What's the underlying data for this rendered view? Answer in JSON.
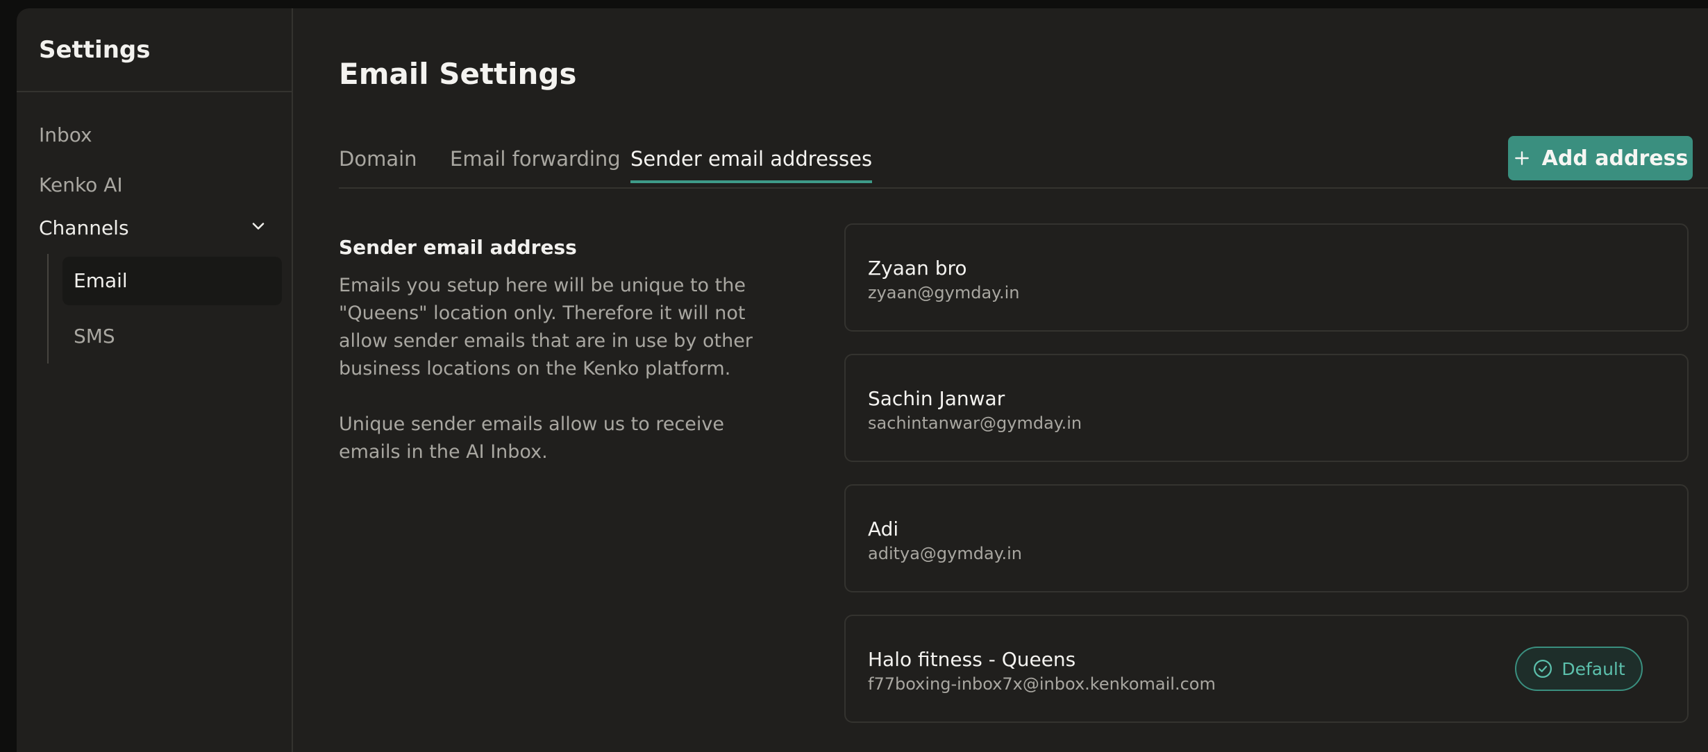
{
  "sidebar": {
    "title": "Settings",
    "items": [
      {
        "label": "Inbox"
      },
      {
        "label": "Kenko AI"
      }
    ],
    "channels": {
      "label": "Channels",
      "subitems": [
        {
          "label": "Email",
          "active": true
        },
        {
          "label": "SMS",
          "active": false
        }
      ]
    }
  },
  "main": {
    "title": "Email Settings",
    "tabs": [
      {
        "label": "Domain",
        "active": false
      },
      {
        "label": "Email forwarding",
        "active": false
      },
      {
        "label": "Sender email addresses",
        "active": true
      }
    ],
    "add_button_label": "Add address",
    "section": {
      "title": "Sender email address",
      "description_1": "Emails you setup here will be unique to the \"Queens\" location only. Therefore it will not allow sender emails that are in use by other business locations on the Kenko platform.",
      "description_2": "Unique sender emails allow us to receive emails in the AI Inbox."
    },
    "addresses": [
      {
        "name": "Zyaan bro",
        "email": "zyaan@gymday.in",
        "default": false
      },
      {
        "name": "Sachin Janwar",
        "email": "sachintanwar@gymday.in",
        "default": false
      },
      {
        "name": "Adi",
        "email": "aditya@gymday.in",
        "default": false
      },
      {
        "name": "Halo fitness - Queens",
        "email": "f77boxing-inbox7x@inbox.kenkomail.com",
        "default": true
      }
    ],
    "default_badge_label": "Default"
  },
  "colors": {
    "accent": "#3a8f7f",
    "background": "#201f1d",
    "border": "#34332f"
  }
}
